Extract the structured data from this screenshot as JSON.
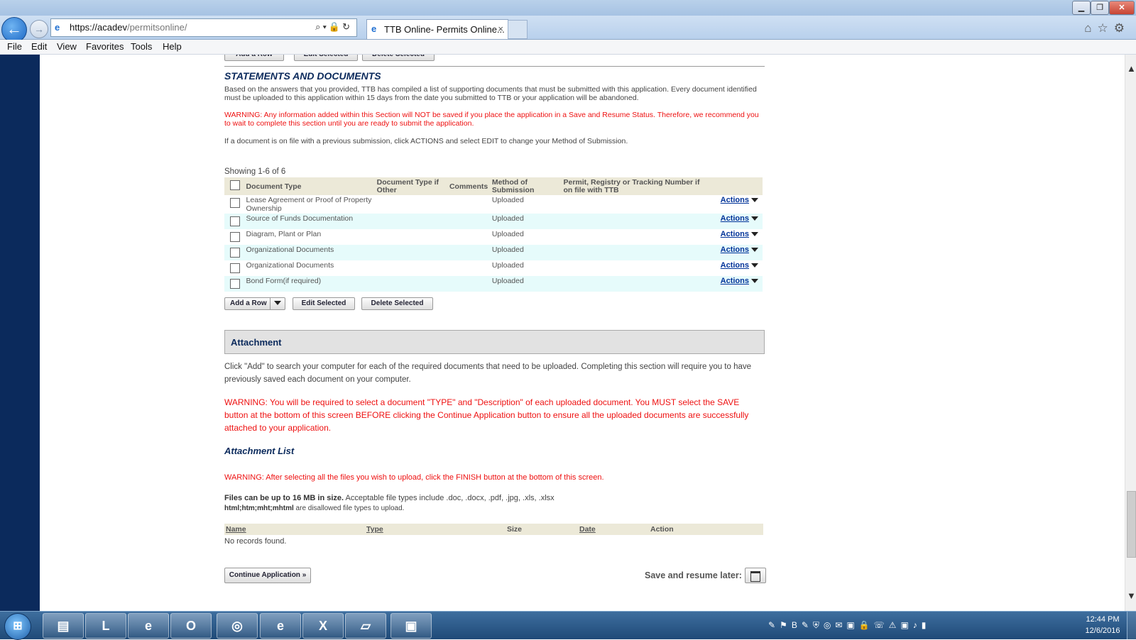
{
  "browser": {
    "url_host": "https://acadev",
    "url_path": "/permitsonline/",
    "tab_title": "TTB Online- Permits Online...",
    "tab_close": "×",
    "menu": [
      "File",
      "Edit",
      "View",
      "Favorites",
      "Tools",
      "Help"
    ],
    "controls": {
      "min": "▁",
      "max": "❐",
      "close": "✕"
    }
  },
  "page": {
    "top_buttons": {
      "add_row": "Add a Row",
      "edit_selected": "Edit Selected",
      "delete_selected": "Delete Selected"
    },
    "statements": {
      "title": "STATEMENTS AND DOCUMENTS",
      "intro": "Based on the answers that you provided, TTB has compiled a list of supporting documents that must be submitted with this application. Every document identified must be uploaded to this application within 15 days from the date you submitted to TTB or your application will be abandoned.",
      "warning": "WARNING: Any information added within this Section will NOT be saved if you place the application in a Save and Resume Status. Therefore, we recommend you to wait to complete this section until you are ready to submit the application.",
      "note": "If a document is on file with a previous submission, click ACTIONS and select EDIT to change your Method of Submission.",
      "showing": "Showing 1-6 of 6",
      "columns": [
        "Document Type",
        "Document Type if Other",
        "Comments",
        "Method of Submission",
        "Permit, Registry or Tracking Number if on file with TTB"
      ],
      "rows": [
        {
          "type": "Lease Agreement or Proof of Property Ownership",
          "method": "Uploaded",
          "action": "Actions"
        },
        {
          "type": "Source of Funds Documentation",
          "method": "Uploaded",
          "action": "Actions"
        },
        {
          "type": "Diagram, Plant or Plan",
          "method": "Uploaded",
          "action": "Actions"
        },
        {
          "type": "Organizational Documents",
          "method": "Uploaded",
          "action": "Actions"
        },
        {
          "type": "Organizational Documents",
          "method": "Uploaded",
          "action": "Actions"
        },
        {
          "type": "Bond Form(if required)",
          "method": "Uploaded",
          "action": "Actions"
        }
      ],
      "buttons": {
        "add_row": "Add a Row",
        "edit_selected": "Edit Selected",
        "delete_selected": "Delete Selected"
      }
    },
    "attachment": {
      "header": "Attachment",
      "intro": "Click \"Add\" to search your computer for each of the required documents that need to be uploaded.  Completing this section will require you to have previously saved each document on your computer.",
      "warning": "WARNING: You will be required to select a document \"TYPE\" and \"Description\" of each uploaded document. You MUST select the SAVE button at the bottom of this screen BEFORE clicking the Continue Application button to ensure all the uploaded documents are successfully attached to your application.",
      "list_title": "Attachment List",
      "list_warning": "WARNING: After selecting all the files you wish to upload, click the FINISH button at the bottom of this screen.",
      "size_bold": "Files can be up to 16 MB in size.",
      "size_rest": "Acceptable file types include .doc, .docx, .pdf, .jpg, .xls, .xlsx",
      "disallowed_bold": "html;htm;mht;mhtml",
      "disallowed_rest": "are disallowed file types to upload.",
      "columns": [
        "Name",
        "Type",
        "Size",
        "Date",
        "Action"
      ],
      "empty": "No records found."
    },
    "footer": {
      "continue": "Continue Application »",
      "save_resume": "Save and resume later:"
    }
  },
  "taskbar": {
    "apps": [
      "explorer-icon",
      "lync-icon",
      "ie-icon",
      "outlook-icon",
      "app-icon",
      "ie-icon",
      "excel-icon",
      "notepad-icon",
      "photos-icon"
    ],
    "time": "12:44 PM",
    "date": "12/6/2016"
  },
  "colors": {
    "navy": "#0b2a5c",
    "warning": "#e11111",
    "table_header": "#ece9d8",
    "row_alt": "#e6fbfb"
  }
}
